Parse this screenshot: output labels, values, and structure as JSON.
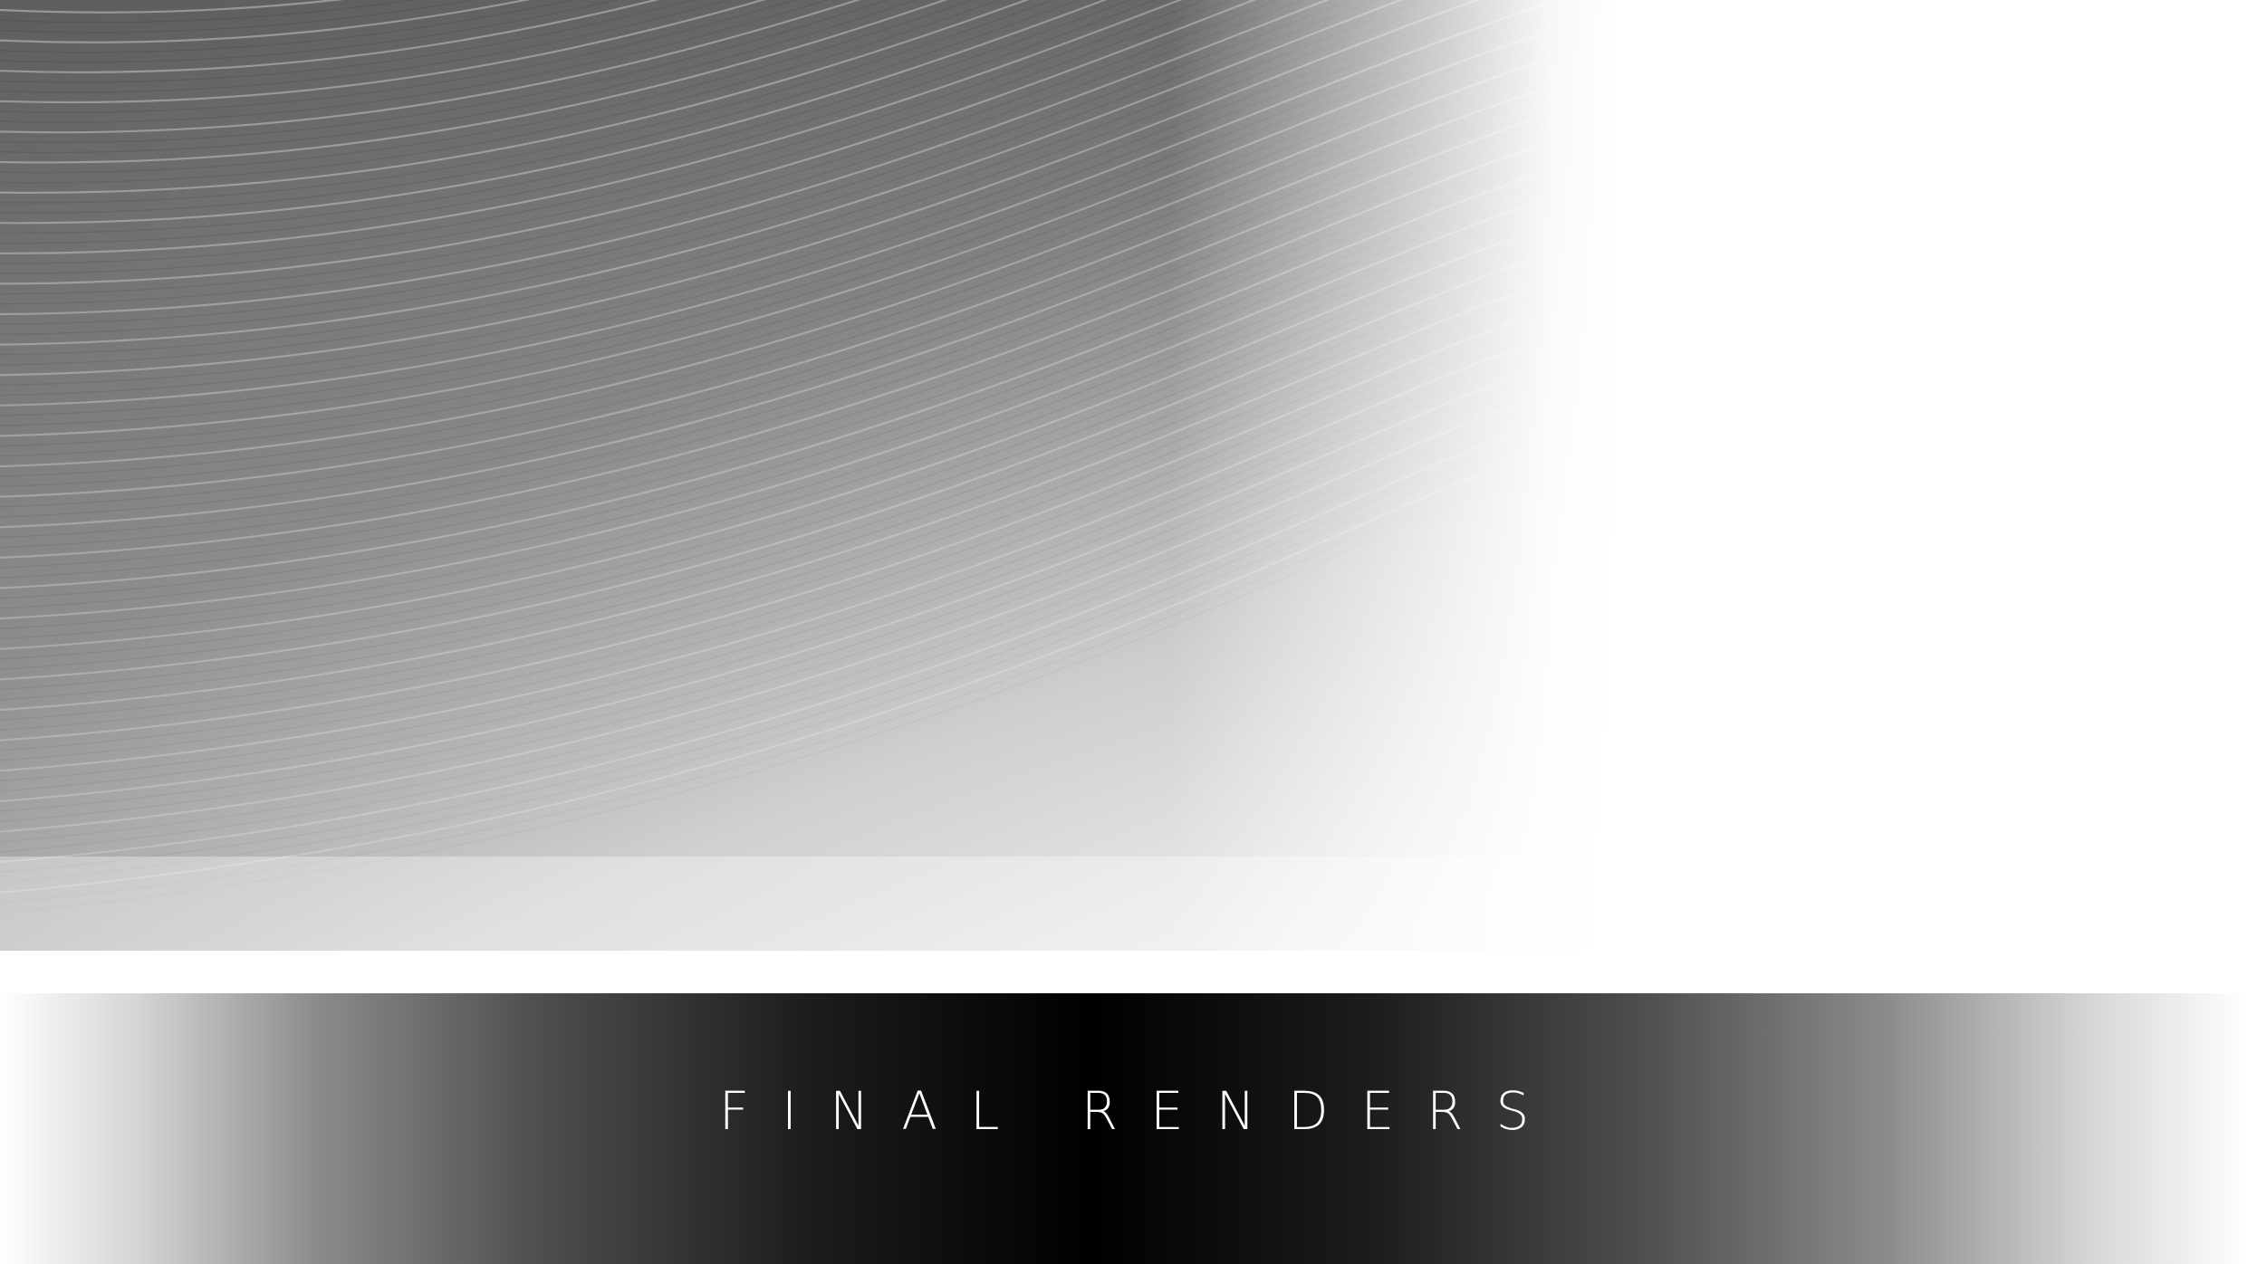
{
  "slide": {
    "title": "FINAL RENDERS",
    "background_image": "paper-stack-waves",
    "colors": {
      "background": "#ffffff",
      "bar_center": "#000000",
      "bar_edges": "#ffffff",
      "title_text": "#ffffff",
      "image_dark": "#6f6f6f",
      "image_light": "#f4f4f4"
    }
  }
}
